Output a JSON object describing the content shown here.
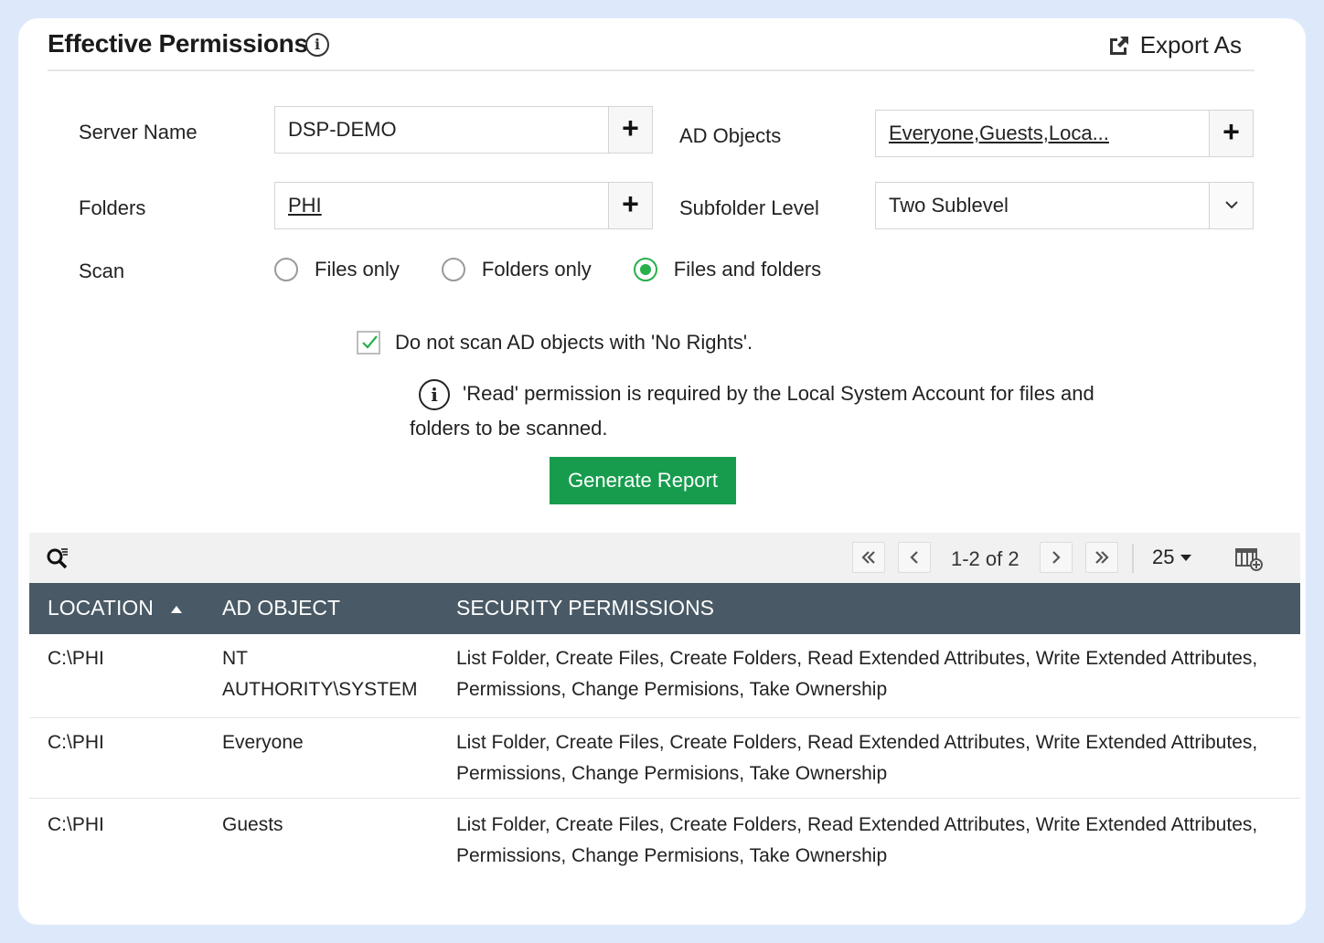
{
  "header": {
    "title": "Effective Permissions",
    "export_label": "Export As"
  },
  "form": {
    "server_name_label": "Server Name",
    "server_name_value": "DSP-DEMO",
    "ad_objects_label": "AD Objects",
    "ad_objects_value": "Everyone,Guests,Loca...",
    "folders_label": "Folders",
    "folders_value": "PHI",
    "subfolder_label": "Subfolder Level",
    "subfolder_value": "Two Sublevel",
    "scan_label": "Scan",
    "scan_options": [
      "Files only",
      "Folders only",
      "Files and folders"
    ],
    "scan_selected": "Files and folders",
    "checkbox_label": "Do not scan AD objects with 'No Rights'.",
    "checkbox_checked": true,
    "note_text": "'Read' permission is required by the Local System Account for files and folders to be scanned.",
    "generate_label": "Generate Report"
  },
  "pagination": {
    "info": "1-2 of 2",
    "per_page": "25"
  },
  "table": {
    "headers": [
      "LOCATION",
      "AD OBJECT",
      "SECURITY PERMISSIONS"
    ],
    "rows": [
      {
        "location": "C:\\PHI",
        "ad_object": "NT AUTHORITY\\SYSTEM",
        "permissions": "List Folder, Create Files, Create Folders, Read Extended Attributes, Write Extended Attributes, Permissions, Change Permisions, Take Ownership"
      },
      {
        "location": "C:\\PHI",
        "ad_object": "Everyone",
        "permissions": "List Folder, Create Files, Create Folders, Read Extended Attributes, Write Extended Attributes, Permissions, Change Permisions, Take Ownership"
      },
      {
        "location": "C:\\PHI",
        "ad_object": "Guests",
        "permissions": "List Folder, Create Files, Create Folders, Read Extended Attributes, Write Extended Attributes, Permissions, Change Permisions, Take Ownership"
      }
    ]
  },
  "colors": {
    "accent_green": "#179c4e",
    "radio_green": "#27b04b",
    "table_header": "#495a66"
  }
}
